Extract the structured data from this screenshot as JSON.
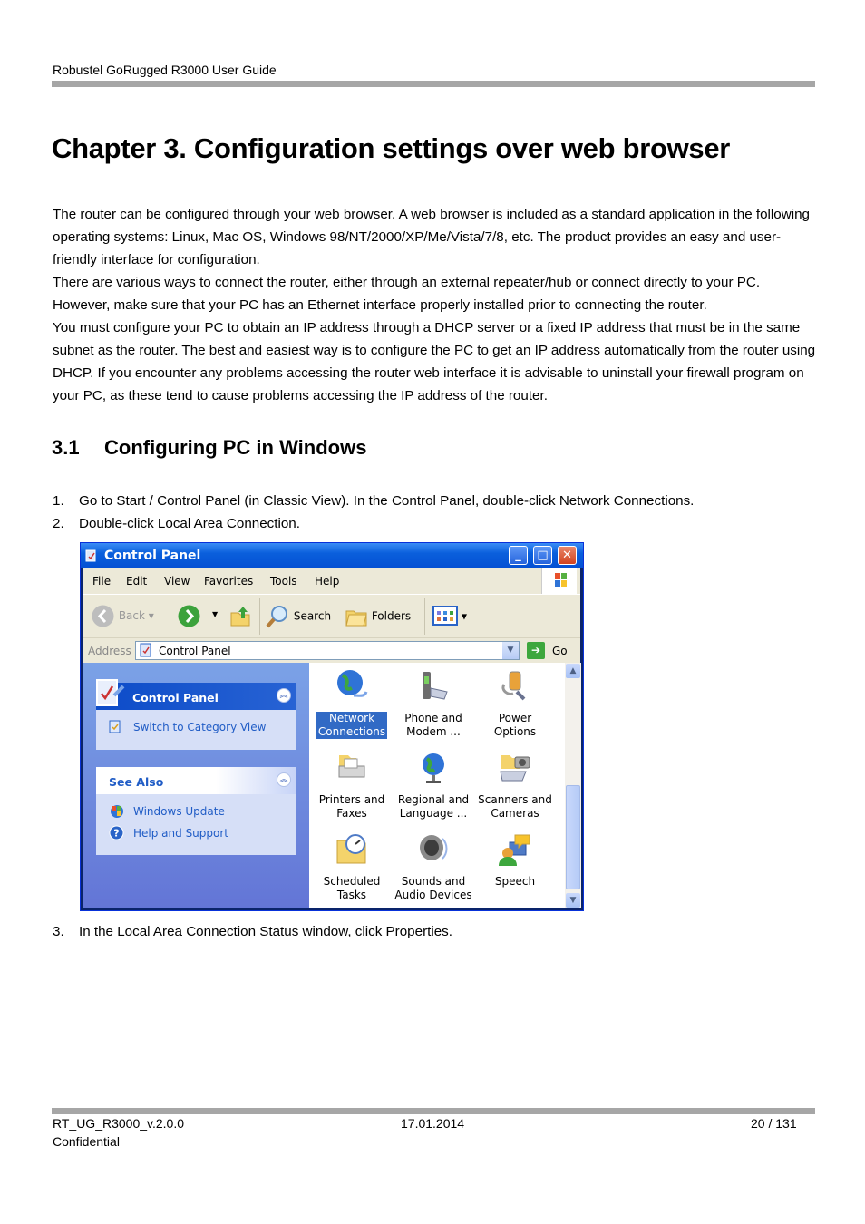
{
  "header": {
    "title": "Robustel GoRugged R3000 User Guide"
  },
  "chapter": {
    "title": "Chapter 3.  Configuration settings over web browser"
  },
  "intro_paragraphs": [
    "The router can be configured through your web browser. A web browser is included as a standard application in the following operating systems: Linux, Mac OS, Windows 98/NT/2000/XP/Me/Vista/7/8, etc. The product provides an easy and user-friendly interface for configuration.",
    "There are various ways to connect the router, either through an external repeater/hub or connect directly to your PC. However, make sure that your PC has an Ethernet interface properly installed prior to connecting the router.",
    "You must configure your PC to obtain an IP address through a DHCP server or a fixed IP address that must be in the same subnet as the router. The best and easiest way is to configure the PC to get an IP address automatically from the router using DHCP. If you encounter any problems accessing the router web interface it is advisable to uninstall your firewall program on your PC, as these tend to cause problems accessing the IP address of the router."
  ],
  "section": {
    "number": "3.1",
    "title": "Configuring PC in Windows"
  },
  "steps": [
    {
      "n": "1.",
      "text": "Go to Start / Control Panel (in Classic View). In the Control Panel, double-click Network Connections."
    },
    {
      "n": "2.",
      "text": "Double-click Local Area Connection."
    },
    {
      "n": "3.",
      "text": "In the Local Area Connection Status window, click Properties."
    }
  ],
  "window": {
    "title": "Control Panel",
    "menu": [
      "File",
      "Edit",
      "View",
      "Favorites",
      "Tools",
      "Help"
    ],
    "toolbar": {
      "back": "Back",
      "search": "Search",
      "folders": "Folders"
    },
    "address": {
      "label": "Address",
      "value": "Control Panel",
      "go": "Go"
    },
    "left_panels": {
      "control_panel": {
        "title": "Control Panel",
        "items": [
          "Switch to Category View"
        ]
      },
      "see_also": {
        "title": "See Also",
        "items": [
          "Windows Update",
          "Help and Support"
        ]
      }
    },
    "icons": [
      {
        "label1": "Network",
        "label2": "Connections",
        "selected": true
      },
      {
        "label1": "Phone and",
        "label2": "Modem ..."
      },
      {
        "label1": "Power Options",
        "label2": ""
      },
      {
        "label1": "Printers and",
        "label2": "Faxes"
      },
      {
        "label1": "Regional and",
        "label2": "Language ..."
      },
      {
        "label1": "Scanners and",
        "label2": "Cameras"
      },
      {
        "label1": "Scheduled",
        "label2": "Tasks"
      },
      {
        "label1": "Sounds and",
        "label2": "Audio Devices"
      },
      {
        "label1": "Speech",
        "label2": ""
      }
    ]
  },
  "footer": {
    "doc_id": "RT_UG_R3000_v.2.0.0",
    "date": "17.01.2014",
    "page": "20 / 131",
    "classification": "Confidential"
  }
}
